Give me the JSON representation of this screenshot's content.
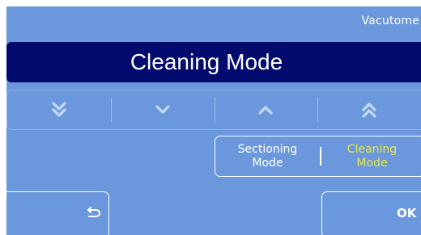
{
  "header": {
    "brand": "Vacutome",
    "title": "Cleaning Mode"
  },
  "navigation": {
    "buttons": [
      {
        "icon": "double-chevron-down-icon"
      },
      {
        "icon": "chevron-down-icon"
      },
      {
        "icon": "chevron-up-icon"
      },
      {
        "icon": "double-chevron-up-icon"
      }
    ]
  },
  "mode_selector": {
    "sectioning_line1": "Sectioning",
    "sectioning_line2": "Mode",
    "cleaning_line1": "Cleaning",
    "cleaning_line2": "Mode",
    "active": "Cleaning Mode"
  },
  "footer": {
    "back_icon": "return-arrow-icon",
    "ok_label": "OK"
  },
  "colors": {
    "background": "#6b98dc",
    "title_bar": "#020a6e",
    "active_text": "#e6e94a",
    "text": "#ffffff"
  }
}
